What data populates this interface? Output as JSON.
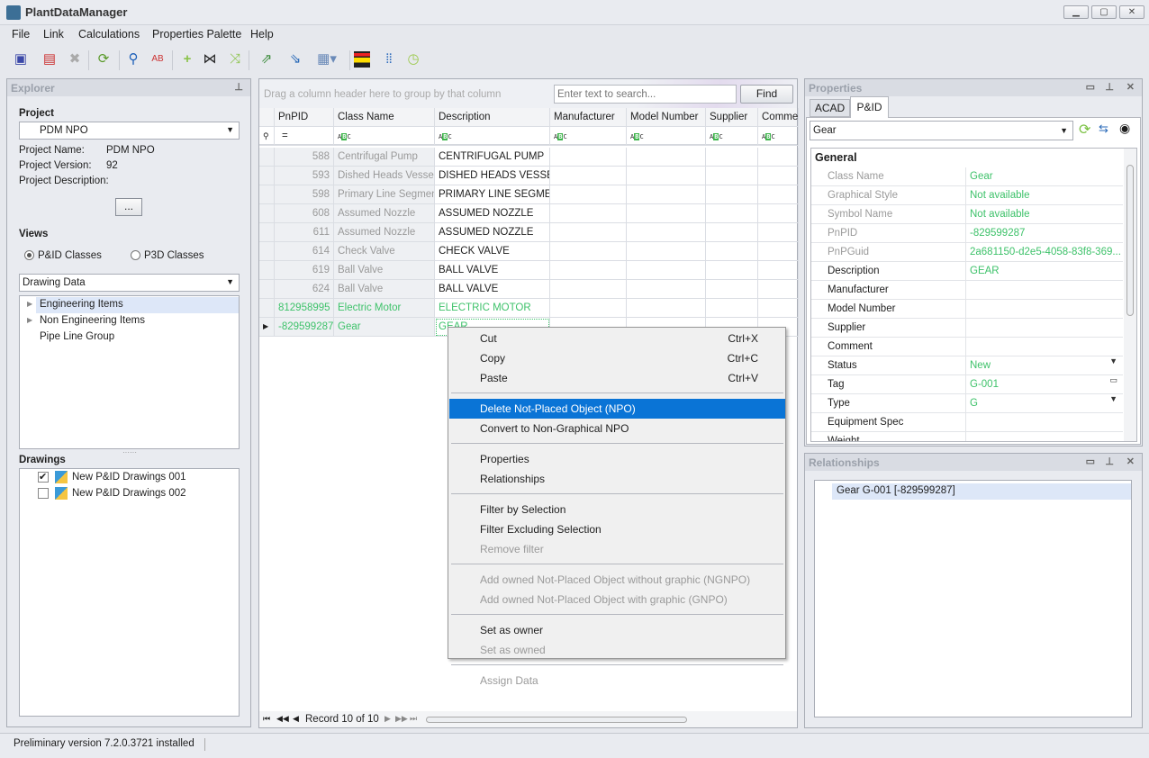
{
  "app": {
    "title": "PlantDataManager",
    "window_buttons": [
      "▁",
      "▢",
      "✕"
    ]
  },
  "menu": [
    "File",
    "Link",
    "Calculations",
    "Properties Palette",
    "Help"
  ],
  "toolbar": [
    "save-icon",
    "close-document-icon",
    "delete-icon",
    "refresh-icon",
    "search-icon",
    "replace-icon",
    "add-icon",
    "add-connector-icon",
    "filter-connector-icon",
    "export-icon",
    "import-icon",
    "grid-layout-icon",
    "color-rows-icon",
    "columns-icon",
    "history-icon"
  ],
  "explorer": {
    "title": "Explorer",
    "project_label": "Project",
    "project_value": "PDM NPO",
    "fields": [
      {
        "k": "Project Name:",
        "v": "PDM NPO"
      },
      {
        "k": "Project Version:",
        "v": "92"
      },
      {
        "k": "Project Description:",
        "v": ""
      }
    ],
    "more_button": "...",
    "views_label": "Views",
    "radio_pid": "P&ID Classes",
    "radio_p3d": "P3D Classes",
    "selected_view": "P&ID Classes",
    "view_dropdown": "Drawing Data",
    "tree": [
      "Engineering Items",
      "Non Engineering Items",
      "Pipe Line Group"
    ],
    "drawings_label": "Drawings",
    "drawings": [
      {
        "name": "New P&ID Drawings 001",
        "checked": true
      },
      {
        "name": "New P&ID Drawings 002",
        "checked": false
      }
    ]
  },
  "grid": {
    "group_hint": "Drag a column header here to group by that column",
    "search_placeholder": "Enter text to search...",
    "find_label": "Find",
    "columns": [
      "PnPID",
      "Class Name",
      "Description",
      "Manufacturer",
      "Model Number",
      "Supplier",
      "Comment"
    ],
    "filter_eq": "=",
    "rows": [
      {
        "id": "588",
        "cls": "Centrifugal Pump",
        "desc": "CENTRIFUGAL PUMP",
        "state": "normal"
      },
      {
        "id": "593",
        "cls": "Dished Heads Vessel",
        "desc": "DISHED HEADS VESSEL",
        "state": "normal"
      },
      {
        "id": "598",
        "cls": "Primary Line Segment",
        "desc": "PRIMARY LINE SEGMENT",
        "state": "normal"
      },
      {
        "id": "608",
        "cls": "Assumed Nozzle",
        "desc": "ASSUMED NOZZLE",
        "state": "normal"
      },
      {
        "id": "611",
        "cls": "Assumed Nozzle",
        "desc": "ASSUMED NOZZLE",
        "state": "normal"
      },
      {
        "id": "614",
        "cls": "Check Valve",
        "desc": "CHECK VALVE",
        "state": "normal"
      },
      {
        "id": "619",
        "cls": "Ball Valve",
        "desc": "BALL VALVE",
        "state": "normal"
      },
      {
        "id": "624",
        "cls": "Ball Valve",
        "desc": "BALL VALVE",
        "state": "normal"
      },
      {
        "id": "812958995",
        "cls": "Electric Motor",
        "desc": "ELECTRIC MOTOR",
        "state": "npo"
      },
      {
        "id": "-829599287",
        "cls": "Gear",
        "desc": "GEAR",
        "state": "npo-current"
      }
    ],
    "record_text": "Record 10 of 10"
  },
  "context_menu": [
    {
      "label": "Cut",
      "shortcut": "Ctrl+X"
    },
    {
      "label": "Copy",
      "shortcut": "Ctrl+C"
    },
    {
      "label": "Paste",
      "shortcut": "Ctrl+V"
    },
    {
      "sep": true
    },
    {
      "label": "Delete Not-Placed Object (NPO)",
      "highlight": true
    },
    {
      "label": "Convert to Non-Graphical NPO"
    },
    {
      "sep": true
    },
    {
      "label": "Properties"
    },
    {
      "label": "Relationships"
    },
    {
      "sep": true
    },
    {
      "label": "Filter by Selection"
    },
    {
      "label": "Filter Excluding Selection"
    },
    {
      "label": "Remove filter",
      "disabled": true
    },
    {
      "sep": true
    },
    {
      "label": "Add owned Not-Placed Object without graphic (NGNPO)",
      "disabled": true
    },
    {
      "label": "Add owned Not-Placed Object with graphic (GNPO)",
      "disabled": true
    },
    {
      "sep": true
    },
    {
      "label": "Set as owner"
    },
    {
      "label": "Set as owned",
      "disabled": true
    },
    {
      "sep": true
    },
    {
      "label": "Assign Data",
      "disabled": true
    }
  ],
  "properties": {
    "title": "Properties",
    "tabs": [
      "ACAD",
      "P&ID"
    ],
    "active_tab": "P&ID",
    "object": "Gear",
    "category": "General",
    "rows": [
      {
        "k": "Class Name",
        "v": "Gear",
        "ro": true
      },
      {
        "k": "Graphical Style",
        "v": "Not available",
        "ro": true
      },
      {
        "k": "Symbol Name",
        "v": "Not available",
        "ro": true
      },
      {
        "k": "PnPID",
        "v": "-829599287",
        "ro": true
      },
      {
        "k": "PnPGuid",
        "v": "2a681150-d2e5-4058-83f8-369...",
        "ro": true
      },
      {
        "k": "Description",
        "v": "GEAR"
      },
      {
        "k": "Manufacturer",
        "v": ""
      },
      {
        "k": "Model Number",
        "v": ""
      },
      {
        "k": "Supplier",
        "v": ""
      },
      {
        "k": "Comment",
        "v": ""
      },
      {
        "k": "Status",
        "v": "New",
        "icon": "▼"
      },
      {
        "k": "Tag",
        "v": "G-001",
        "icon": "▭"
      },
      {
        "k": "Type",
        "v": "G",
        "icon": "▼"
      },
      {
        "k": "Equipment Spec",
        "v": ""
      },
      {
        "k": "Weight",
        "v": ""
      }
    ]
  },
  "relationships": {
    "title": "Relationships",
    "items": [
      "Gear G-001 [-829599287]"
    ]
  },
  "status": "Preliminary version 7.2.0.3721 installed",
  "colors": {
    "accent": "#0a74d6",
    "npo_text": "#3ec26a",
    "selection": "#dde7f8"
  }
}
